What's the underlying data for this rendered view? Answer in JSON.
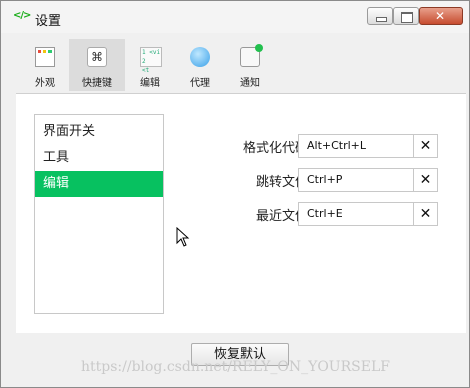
{
  "window": {
    "title": "设置",
    "app_icon": "</>"
  },
  "toolbar": {
    "items": [
      {
        "label": "外观",
        "icon": "appearance-icon",
        "active": false
      },
      {
        "label": "快捷键",
        "icon": "shortcut-key-icon",
        "glyph": "⌘",
        "active": true
      },
      {
        "label": "编辑",
        "icon": "code-edit-icon",
        "active": false
      },
      {
        "label": "代理",
        "icon": "globe-icon",
        "active": false
      },
      {
        "label": "通知",
        "icon": "notification-icon",
        "active": false
      }
    ]
  },
  "sidebar": {
    "items": [
      {
        "label": "界面开关",
        "selected": false
      },
      {
        "label": "工具",
        "selected": false
      },
      {
        "label": "编辑",
        "selected": true
      }
    ]
  },
  "shortcuts": [
    {
      "label": "格式化代码",
      "value": "Alt+Ctrl+L",
      "clear": "✕"
    },
    {
      "label": "跳转文件",
      "value": "Ctrl+P",
      "clear": "✕"
    },
    {
      "label": "最近文件",
      "value": "Ctrl+E",
      "clear": "✕"
    }
  ],
  "footer": {
    "reset_label": "恢复默认",
    "watermark": "https://blog.csdn.net/RELY_ON_YOURSELF"
  },
  "colors": {
    "accent": "#07c160",
    "notify_dot": "#22c04e"
  }
}
